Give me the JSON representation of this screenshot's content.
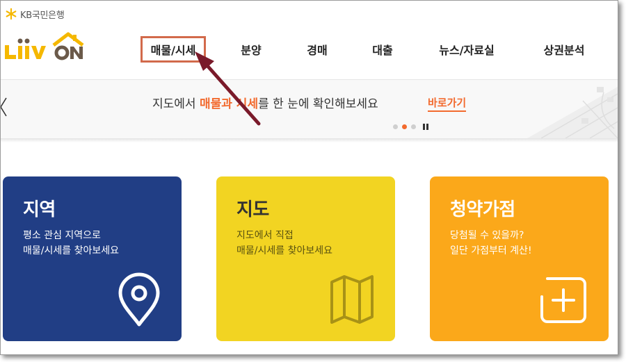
{
  "brand": {
    "bank_name": "KB국민은행",
    "logo_text": "Liiv ON"
  },
  "nav": {
    "items": [
      {
        "label": "매물/시세",
        "highlighted": true
      },
      {
        "label": "분양"
      },
      {
        "label": "경매"
      },
      {
        "label": "대출"
      },
      {
        "label": "뉴스/자료실"
      },
      {
        "label": "상권분석"
      }
    ]
  },
  "banner": {
    "text_before": "지도에서 ",
    "text_highlight": "매물과 시세",
    "text_after": "를 한 눈에 확인해보세요",
    "link_label": "바로가기",
    "slide_count": 3,
    "active_slide_index": 1
  },
  "cards": [
    {
      "title": "지역",
      "desc_line1": "평소 관심 지역으로",
      "desc_line2": "매물/시세를 찾아보세요",
      "icon": "location-pin-icon",
      "color": "#213e85"
    },
    {
      "title": "지도",
      "desc_line1": "지도에서 직접",
      "desc_line2": "매물/시세를 찾아보세요",
      "icon": "folded-map-icon",
      "color": "#f2d422"
    },
    {
      "title": "청약가점",
      "desc_line1": "당첨될 수 있을까?",
      "desc_line2": "일단 가점부터 계산!",
      "icon": "plus-box-icon",
      "color": "#fba81a"
    }
  ],
  "colors": {
    "accent": "#f26a2e",
    "highlight_box": "#d26a4b",
    "arrow": "#7a1a2a"
  }
}
